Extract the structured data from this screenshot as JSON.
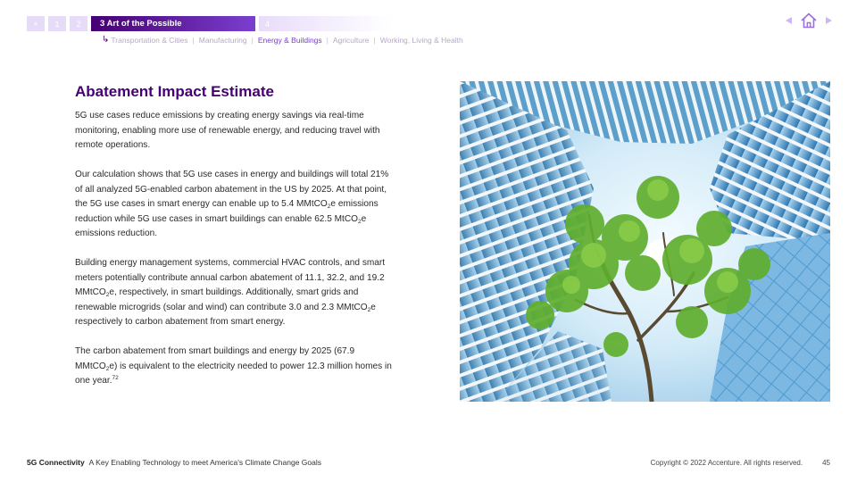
{
  "nav": {
    "tabs": [
      {
        "label": "+"
      },
      {
        "label": "1"
      },
      {
        "label": "2"
      },
      {
        "label": "3  Art of the Possible"
      },
      {
        "label": "4"
      }
    ],
    "subnav": [
      {
        "label": "Transportation & Cities"
      },
      {
        "label": "Manufacturing"
      },
      {
        "label": "Energy & Buildings"
      },
      {
        "label": "Agriculture"
      },
      {
        "label": "Working, Living & Health"
      }
    ],
    "separator": "|"
  },
  "content": {
    "title": "Abatement Impact Estimate",
    "p1": "5G use cases reduce emissions by creating energy savings via real-time monitoring, enabling more use of renewable energy, and reducing travel with remote operations.",
    "p2": {
      "a": "Our calculation shows that 5G use cases in energy and buildings will total 21% of all analyzed 5G-enabled carbon abatement in the US by 2025. At that point, the 5G use cases in smart energy can enable up to 5.4 MMtCO",
      "sub1": "2",
      "b": "e emissions reduction while 5G use cases in smart buildings can enable 62.5 MtCO",
      "sub2": "2",
      "c": "e emissions reduction."
    },
    "p3": {
      "a": "Building energy management systems, commercial HVAC controls, and smart meters potentially contribute annual carbon abatement of 11.1, 32.2, and 19.2 MMtCO",
      "sub1": "2",
      "b": "e, respectively, in smart buildings. Additionally, smart grids and renewable microgrids (solar and wind) can contribute 3.0 and 2.3 MMtCO",
      "sub2": "2",
      "c": "e respectively to carbon abatement from smart energy."
    },
    "p4": {
      "a": "The carbon abatement from smart buildings and energy by 2025 (67.9 MMtCO",
      "sub1": "2",
      "b": "e) is equivalent to the electricity needed to power 12.3 million homes in one year.",
      "sup": "72"
    }
  },
  "footer": {
    "brand": "5G Connectivity",
    "subtitle": "A Key Enabling Technology to meet America's Climate Change Goals",
    "copyright": "Copyright © 2022 Accenture. All rights reserved.",
    "page": "45"
  },
  "colors": {
    "accent": "#460073",
    "accent_light": "#7b3fd0",
    "tab_light": "#e6dcf8"
  }
}
